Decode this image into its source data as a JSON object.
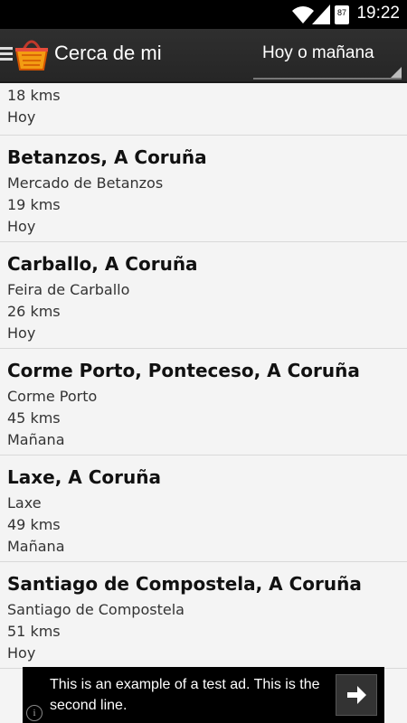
{
  "status_bar": {
    "time": "19:22",
    "battery": "87",
    "icons": [
      "wifi-icon",
      "signal-icon",
      "battery-icon"
    ]
  },
  "action_bar": {
    "title": "Cerca de mi",
    "filter_selected": "Hoy o mañana",
    "icons": [
      "menu-icon",
      "basket-icon"
    ]
  },
  "list": {
    "partial_item": {
      "distance": "18 kms",
      "when": "Hoy"
    },
    "items": [
      {
        "name": "Betanzos, A Coruña",
        "market": "Mercado de Betanzos",
        "distance": "19 kms",
        "when": "Hoy"
      },
      {
        "name": "Carballo, A Coruña",
        "market": "Feira de Carballo",
        "distance": "26 kms",
        "when": "Hoy"
      },
      {
        "name": "Corme Porto, Ponteceso, A Coruña",
        "market": "Corme Porto",
        "distance": "45 kms",
        "when": "Mañana"
      },
      {
        "name": "Laxe, A Coruña",
        "market": "Laxe",
        "distance": "49 kms",
        "when": "Mañana"
      },
      {
        "name": "Santiago de Compostela, A Coruña",
        "market": "Santiago de Compostela",
        "distance": "51 kms",
        "when": "Hoy"
      }
    ]
  },
  "ad": {
    "text": "This is an example of a test ad. This is the second line.",
    "info_symbol": "i"
  }
}
